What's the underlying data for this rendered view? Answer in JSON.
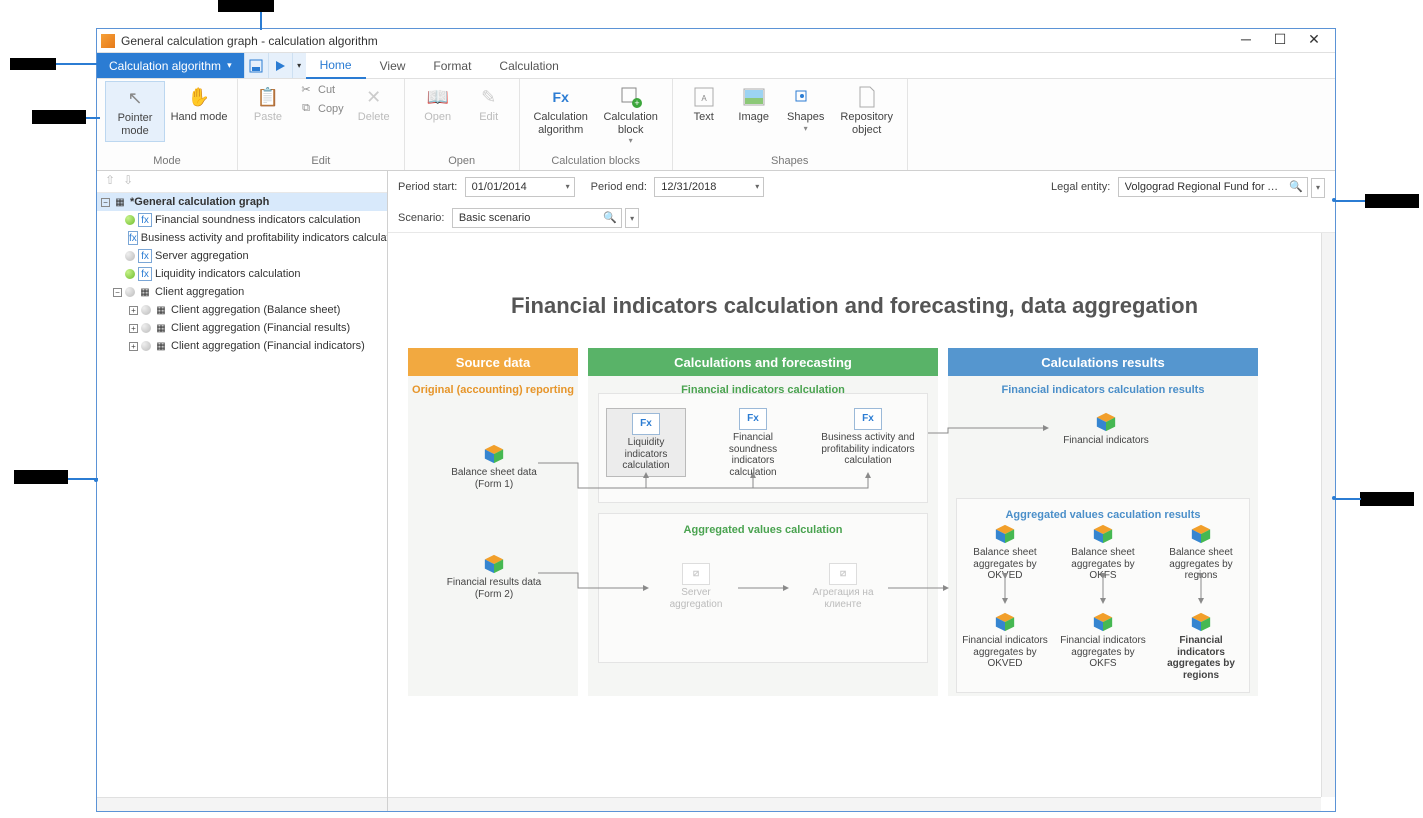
{
  "window": {
    "title": "General calculation graph - calculation algorithm"
  },
  "ribbon": {
    "menu_btn": "Calculation algorithm",
    "tabs": {
      "home": "Home",
      "view": "View",
      "format": "Format",
      "calculation": "Calculation"
    },
    "groups": {
      "mode": "Mode",
      "edit": "Edit",
      "open": "Open",
      "blocks": "Calculation blocks",
      "shapes": "Shapes"
    },
    "btns": {
      "pointer": "Pointer mode",
      "hand": "Hand mode",
      "paste": "Paste",
      "cut": "Cut",
      "copy": "Copy",
      "delete": "Delete",
      "open": "Open",
      "edit": "Edit",
      "calc_alg": "Calculation algorithm",
      "calc_block": "Calculation block",
      "text": "Text",
      "image": "Image",
      "shapes": "Shapes",
      "repo": "Repository object"
    }
  },
  "params": {
    "period_start_lbl": "Period start:",
    "period_start": "01/01/2014",
    "period_end_lbl": "Period end:",
    "period_end": "12/31/2018",
    "legal_lbl": "Legal entity:",
    "legal": "Volgograd Regional Fund for Animal",
    "scenario_lbl": "Scenario:",
    "scenario": "Basic scenario"
  },
  "tree": {
    "root": "*General calculation graph",
    "n1": "Financial soundness indicators calculation",
    "n2": "Business activity and profitability indicators calculation",
    "n3": "Server aggregation",
    "n4": "Liquidity indicators calculation",
    "n5": "Client aggregation",
    "n5a": "Client aggregation (Balance sheet)",
    "n5b": "Client aggregation (Financial results)",
    "n5c": "Client aggregation (Financial indicators)"
  },
  "diagram": {
    "title": "Financial indicators calculation and forecasting, data aggregation",
    "lanes": {
      "source": "Source data",
      "calc": "Calculations and forecasting",
      "results": "Calculations results"
    },
    "source": {
      "sub": "Original (accounting) reporting",
      "n1": "Balance sheet data (Form 1)",
      "n2": "Financial results data (Form 2)"
    },
    "calc": {
      "sub1": "Financial indicators calculation",
      "liq": "Liquidity indicators calculation",
      "fin": "Financial soundness indicators calculation",
      "bus": "Business activity and profitability indicators calculation",
      "sub2": "Aggregated values calculation",
      "srv": "Server aggregation",
      "cli": "Агрегация на клиенте"
    },
    "results": {
      "sub1": "Financial indicators calculation results",
      "fin_ind": "Financial indicators",
      "sub2": "Aggregated values caculation results",
      "bs_okved": "Balance sheet aggregates by OKVED",
      "bs_okfs": "Balance sheet aggregates by OKFS",
      "bs_reg": "Balance sheet aggregates by regions",
      "fi_okved": "Financial indicators aggregates by OKVED",
      "fi_okfs": "Financial indicators aggregates by OKFS",
      "fi_reg": "Financial indicators aggregates by regions"
    }
  }
}
